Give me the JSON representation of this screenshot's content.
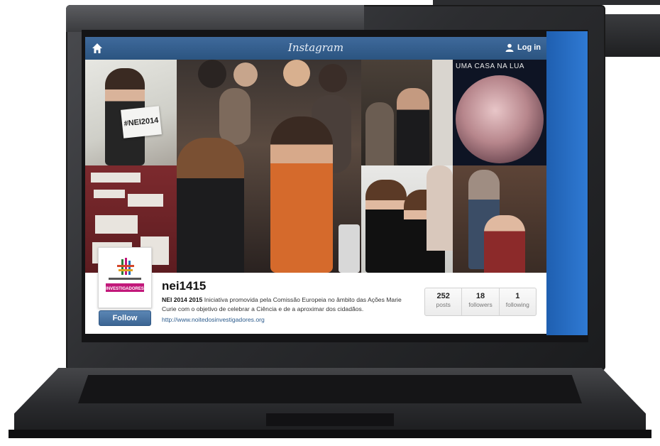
{
  "header": {
    "brand": "Instagram",
    "login_label": "Log in"
  },
  "photos": {
    "sign_text": "#NEI2014",
    "poster_title": "UMA CASA NA LUA"
  },
  "profile": {
    "username": "nei1415",
    "bio_lead": "NEI 2014 2015",
    "bio_text": " Iniciativa promovida pela Comissão Europeia no âmbito das Ações Marie Curie com o objetivo de celebrar a Ciência e de a aproximar dos cidadãos.",
    "website": "http://www.noitedosinvestigadores.org",
    "follow_label": "Follow",
    "logo_text": "INVESTIGADORES",
    "stats": [
      {
        "value": "252",
        "label": "posts"
      },
      {
        "value": "18",
        "label": "followers"
      },
      {
        "value": "1",
        "label": "following"
      }
    ]
  },
  "colors": {
    "header": "#2b5480",
    "follow_button": "#3c6593",
    "link": "#2c5b8c",
    "logo_accent": "#c2187a"
  },
  "icons": [
    "home-icon",
    "user-icon"
  ]
}
